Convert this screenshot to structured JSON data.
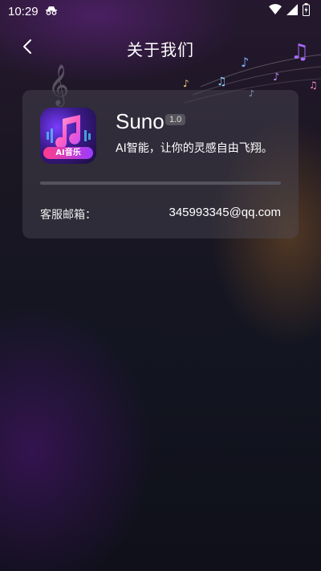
{
  "status_bar": {
    "time": "10:29",
    "icons": [
      "incognito-icon",
      "wifi-icon",
      "signal-icon",
      "battery-icon"
    ]
  },
  "nav": {
    "back_icon": "chevron-left-icon",
    "title": "关于我们"
  },
  "app": {
    "icon": "music-note-icon",
    "icon_badge": "AI音乐",
    "name": "Suno",
    "version": "1.0",
    "slogan": "AI智能，让你的灵感自由飞翔。"
  },
  "contact": {
    "email_label": "客服邮箱：",
    "email_value": "345993345@qq.com"
  },
  "colors": {
    "card_bg": "#4e4c58",
    "badge_gradient_start": "#ff3d8b",
    "badge_gradient_end": "#9a3cff"
  }
}
